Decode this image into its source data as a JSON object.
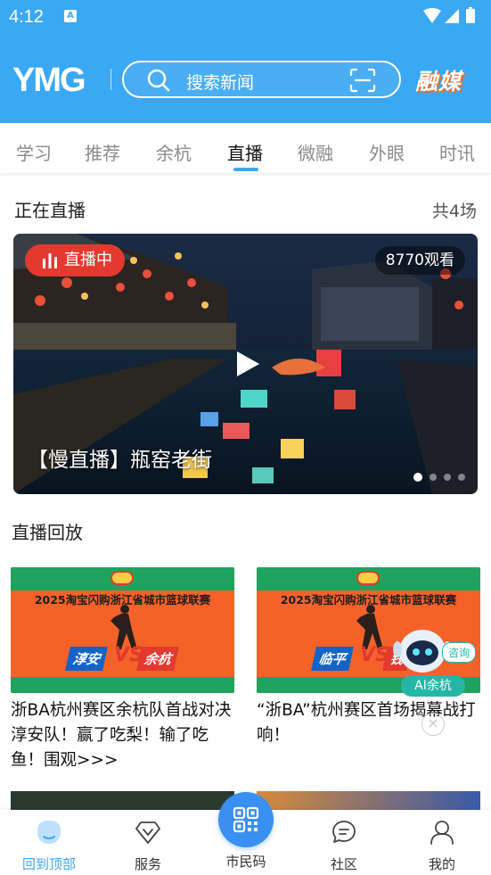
{
  "status_bar": {
    "time": "4:12"
  },
  "header": {
    "logo": "YMG",
    "search_placeholder": "搜索新闻",
    "brand": "融媒"
  },
  "tabs": [
    {
      "label": "学习"
    },
    {
      "label": "推荐"
    },
    {
      "label": "余杭"
    },
    {
      "label": "直播",
      "active": true
    },
    {
      "label": "微融"
    },
    {
      "label": "外眼"
    },
    {
      "label": "时讯"
    }
  ],
  "live": {
    "section_title": "正在直播",
    "count": "共4场",
    "badge": "直播中",
    "views": "8770观看",
    "title": "【慢直播】瓶窑老街",
    "carousel_pages": 4,
    "carousel_active": 1
  },
  "replay": {
    "section_title": "直播回放",
    "cards": [
      {
        "league": "2025淘宝闪购浙江省城市篮球联赛",
        "team_left": "淳安",
        "vs": "VS",
        "team_right": "余杭",
        "title": "浙BA杭州赛区余杭队首战对决淳安队！赢了吃梨！输了吃鱼！围观>>>"
      },
      {
        "league": "2025淘宝闪购浙江省城市篮球联赛",
        "team_left": "临平",
        "vs": "VS",
        "team_right": "钱",
        "title": "“浙BA”杭州赛区首场揭幕战打响！"
      }
    ]
  },
  "ai_assistant": {
    "bubble": "咨询",
    "label": "AI余杭",
    "close": "×"
  },
  "bottom_nav": {
    "items": [
      {
        "label": "回到顶部",
        "active": true
      },
      {
        "label": "服务"
      },
      {
        "label": "市民码"
      },
      {
        "label": "社区"
      },
      {
        "label": "我的"
      }
    ]
  },
  "colors": {
    "primary": "#3aa8f3",
    "live_red": "#e3392f",
    "ai_teal": "#26b6a8"
  }
}
